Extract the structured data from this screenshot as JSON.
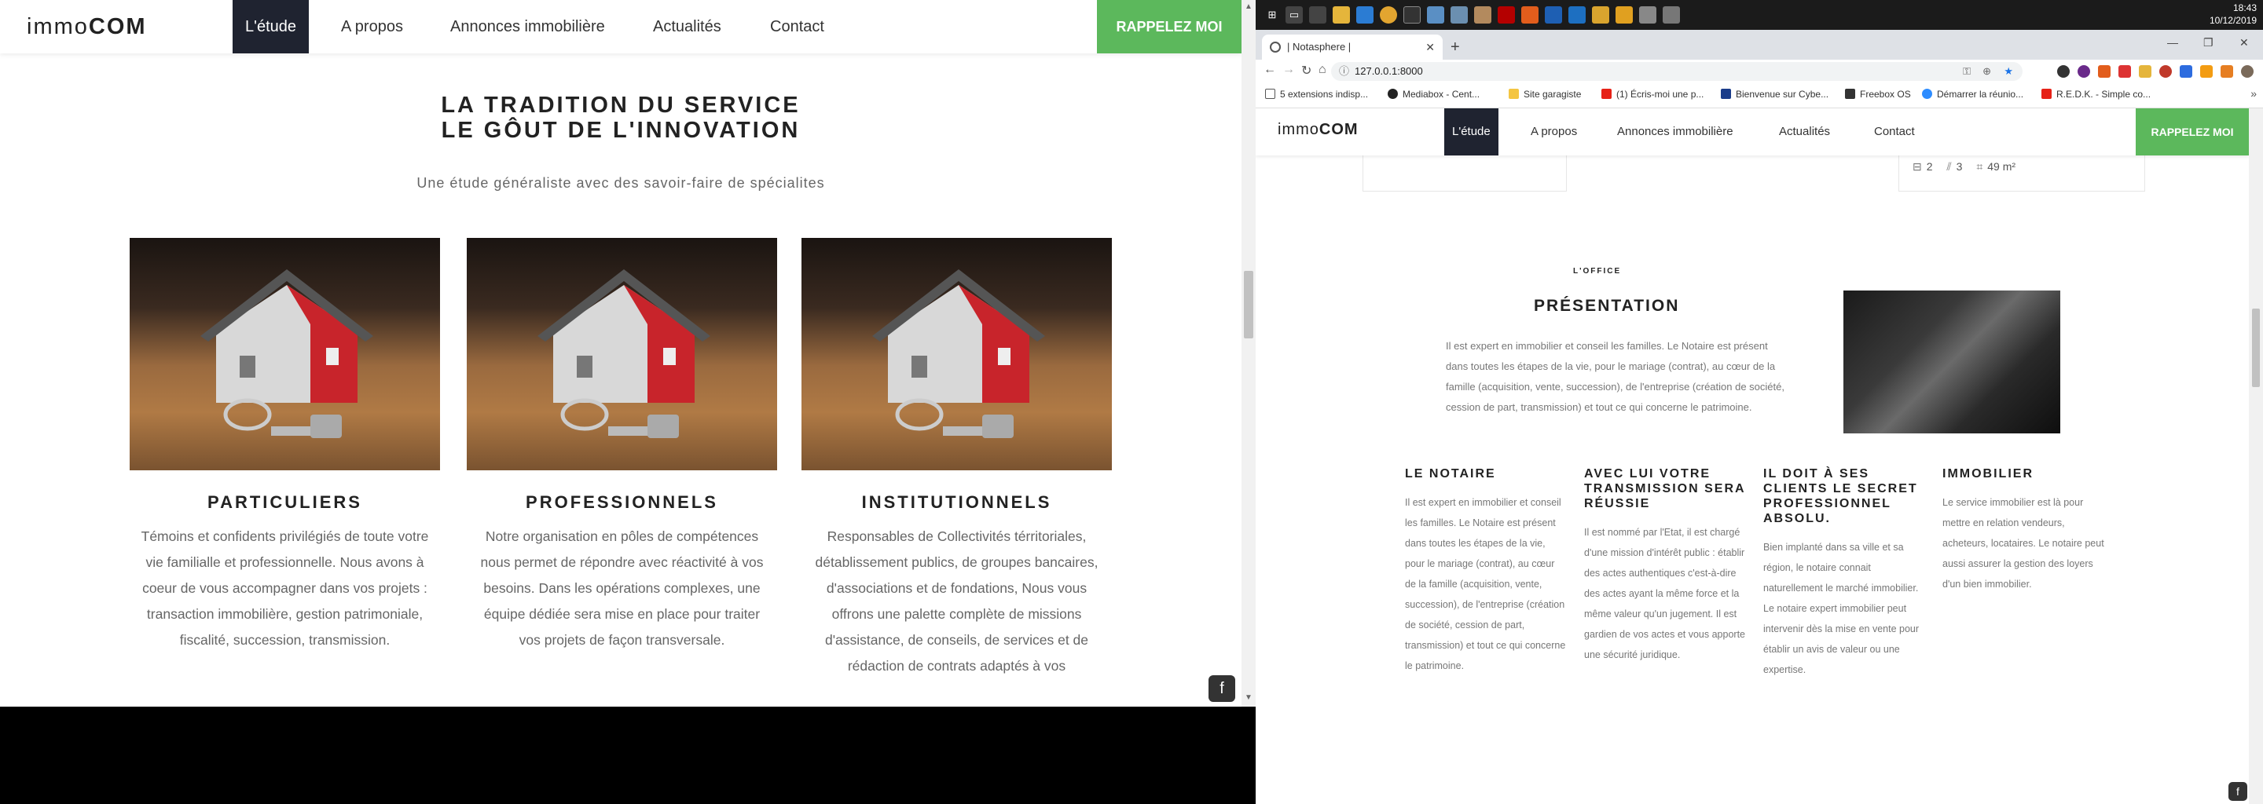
{
  "left": {
    "logo_light": "immo",
    "logo_bold": "COM",
    "nav": [
      "L'étude",
      "A propos",
      "Annonces immobilière",
      "Actualités",
      "Contact"
    ],
    "cta": "RAPPELEZ MOI",
    "headline_1": "LA TRADITION DU SERVICE",
    "headline_2": "LE GÔUT DE L'INNOVATION",
    "subtitle": "Une étude généraliste avec des savoir-faire de spécialites",
    "cards": [
      {
        "title": "PARTICULIERS",
        "text": "Témoins et confidents privilégiés de toute votre vie familialle et professionnelle. Nous avons à coeur de vous accompagner dans vos projets : transaction immobilière, gestion patrimoniale, fiscalité, succession, transmission."
      },
      {
        "title": "PROFESSIONNELS",
        "text": "Notre organisation en pôles de compétences nous permet de répondre avec réactivité à vos besoins. Dans les opérations complexes, une équipe dédiée sera mise en place pour traiter vos projets de façon transversale."
      },
      {
        "title": "INSTITUTIONNELS",
        "text": "Responsables de Collectivités térritoriales, détablissement publics, de groupes bancaires, d'associations et de fondations, Nous vous offrons une palette complète de missions d'assistance, de conseils, de services et de rédaction de contrats adaptés à vos"
      }
    ],
    "badge_icon": "f"
  },
  "right": {
    "taskbar": {
      "time": "18:43",
      "date": "10/12/2019"
    },
    "tab_title": "| Notasphere |",
    "url": "127.0.0.1:8000",
    "bookmarks": [
      "5 extensions indisp...",
      "Mediabox - Cent...",
      "Site garagiste",
      "(1) Écris-moi une p...",
      "Bienvenue sur Cybe...",
      "Freebox OS",
      "Démarrer la réunio...",
      "R.E.D.K. - Simple co..."
    ],
    "logo_light": "immo",
    "logo_bold": "COM",
    "nav": [
      "L'étude",
      "A propos",
      "Annonces immobilière",
      "Actualités",
      "Contact"
    ],
    "cta": "RAPPELEZ MOI",
    "property_stats": {
      "beds": "2",
      "baths": "3",
      "area": "49 m²"
    },
    "eyebrow": "L'OFFICE",
    "title": "PRÉSENTATION",
    "intro": "Il est expert en immobilier et conseil les familles. Le Notaire est présent dans toutes les étapes de la vie, pour le mariage (contrat), au cœur de la famille (acquisition, vente, succession), de l'entreprise (création de société, cession de part, transmission) et tout ce qui concerne le patrimoine.",
    "columns": [
      {
        "title": "LE NOTAIRE",
        "text": "Il est expert en immobilier et conseil les familles. Le Notaire est présent dans toutes les étapes de la vie, pour le mariage (contrat), au cœur de la famille (acquisition, vente, succession), de l'entreprise (création de société, cession de part, transmission) et tout ce qui concerne le patrimoine."
      },
      {
        "title": "AVEC LUI VOTRE TRANSMISSION SERA RÉUSSIE",
        "text": "Il est nommé par l'Etat, il est chargé d'une mission d'intérêt public : établir des actes authentiques c'est-à-dire des actes ayant la même force et la même valeur qu'un jugement. Il est gardien de vos actes et vous apporte une sécurité juridique."
      },
      {
        "title": "IL DOIT À SES CLIENTS LE SECRET PROFESSIONNEL ABSOLU.",
        "text": "Bien implanté dans sa ville et sa région, le notaire connait naturellement le marché immobilier. Le notaire expert immobilier peut intervenir dès la mise en vente pour établir un avis de valeur ou une expertise."
      },
      {
        "title": "IMMOBILIER",
        "text": "Le service immobilier est là pour mettre en relation vendeurs, acheteurs, locataires. Le notaire peut aussi assurer la gestion des loyers d'un bien immobilier."
      }
    ]
  }
}
